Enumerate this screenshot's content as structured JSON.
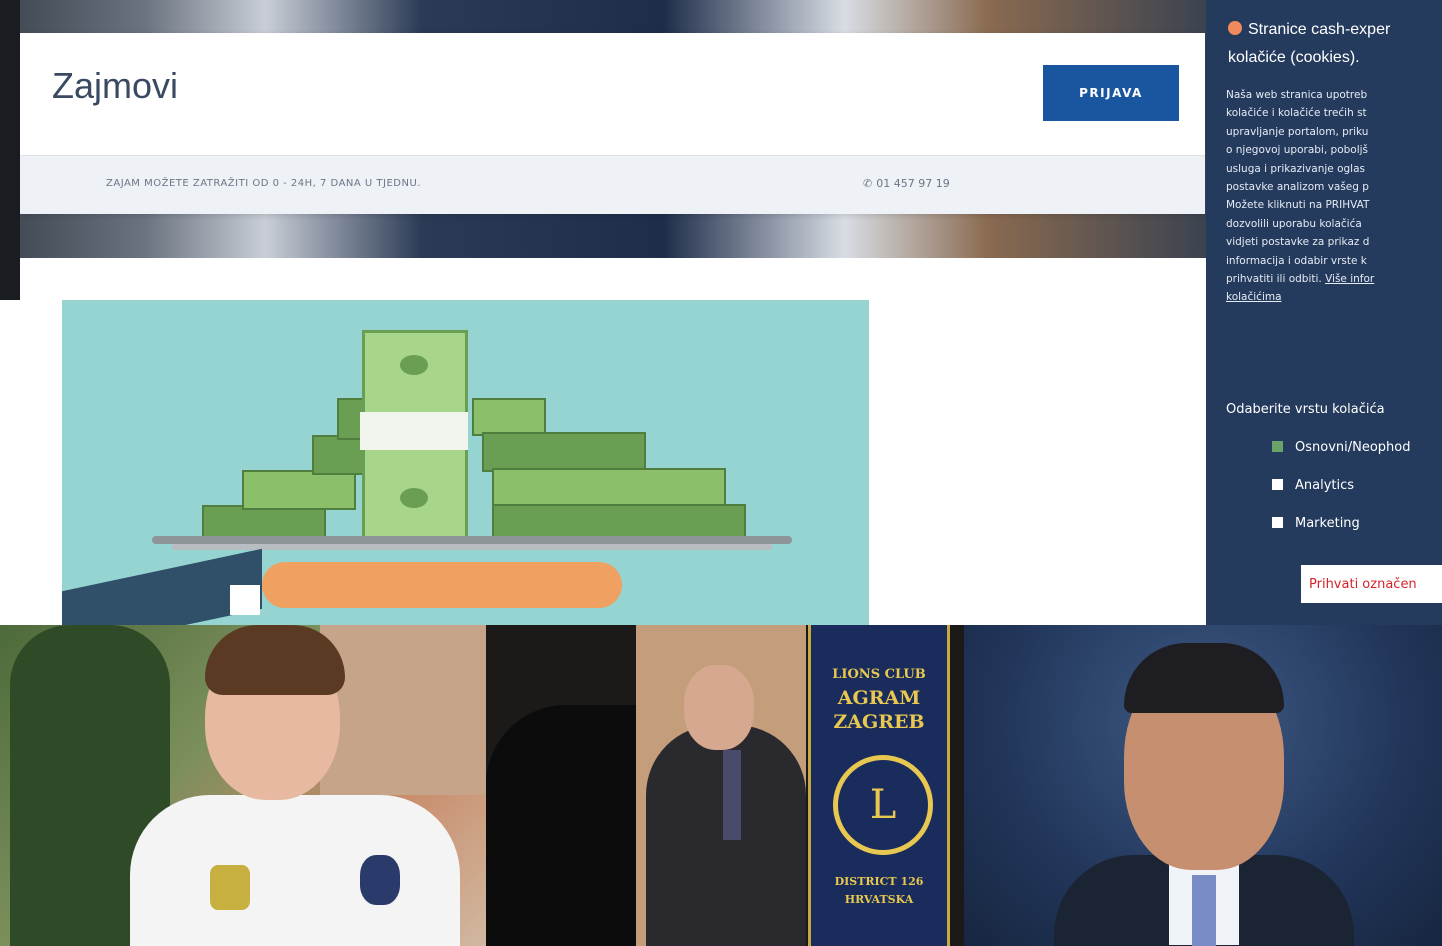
{
  "header": {
    "brand": "Zajmovi",
    "login_label": "PRIJAVA",
    "info_text": "ZAJAM MOŽETE ZATRAŽITI OD 0 - 24H, 7 DANA U TJEDNU.",
    "phone": "01 457 97 19"
  },
  "cookie_panel": {
    "title_line1": "Stranice cash-exper",
    "title_line2": "kolačiće (cookies).",
    "body_lines": [
      "Naša web stranica upotreb",
      "kolačiće i kolačiće trećih st",
      "upravljanje portalom, priku",
      "o njegovoj uporabi, poboljš",
      "usluga i prikazivanje oglas",
      "postavke analizom vašeg p",
      "Možete kliknuti na PRIHVAT",
      "dozvolili uporabu kolačića",
      "vidjeti postavke za prikaz d",
      "informacija i odabir vrste k",
      "prihvatiti ili odbiti."
    ],
    "more_link": "Više infor",
    "more_link_line2": "kolačićima",
    "choose_label": "Odaberite vrstu kolačića",
    "options": [
      {
        "label": "Osnovni/Neophod",
        "checked": true
      },
      {
        "label": "Analytics",
        "checked": false
      },
      {
        "label": "Marketing",
        "checked": false
      }
    ],
    "accept_label": "Prihvati označen"
  },
  "photos": {
    "banner_line1": "LIONS CLUB",
    "banner_line2": "AGRAM",
    "banner_line3": "ZAGREB",
    "banner_emblem": "L",
    "banner_bottom1": "DISTRICT 126",
    "banner_bottom2": "HRVATSKA"
  },
  "colors": {
    "primary_button": "#1a56a0",
    "cookie_bg": "#253b5e",
    "accept_text": "#d4242a",
    "illustration_bg": "#95d4d1"
  }
}
